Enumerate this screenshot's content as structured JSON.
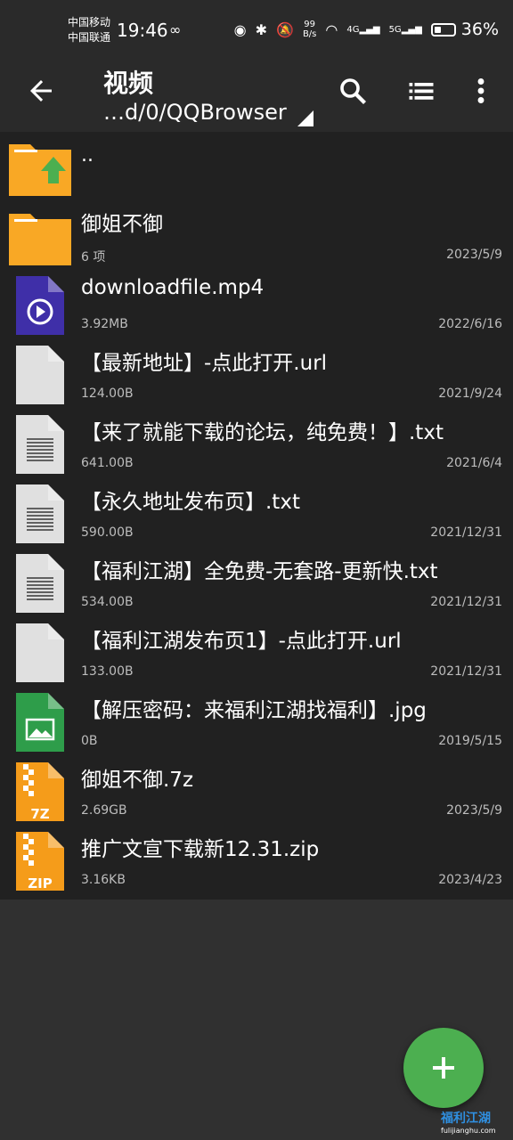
{
  "status": {
    "carrier1": "中国移动",
    "carrier2": "中国联通",
    "time": "19:46",
    "speed_value": "99",
    "speed_unit": "B/s",
    "signal1": "4G",
    "signal2": "5G",
    "battery": "36%",
    "battery_level": 0.36
  },
  "appbar": {
    "title": "视频",
    "path": "…d/0/QQBrowser"
  },
  "parent_dir": "..",
  "files": [
    {
      "name": "御姐不御",
      "meta": "6 项",
      "date": "2023/5/9",
      "type": "folder"
    },
    {
      "name": "downloadfile.mp4",
      "meta": "3.92MB",
      "date": "2022/6/16",
      "type": "video"
    },
    {
      "name": "【最新地址】-点此打开.url",
      "meta": "124.00B",
      "date": "2021/9/24",
      "type": "blank"
    },
    {
      "name": "【来了就能下载的论坛，纯免费！】.txt",
      "meta": "641.00B",
      "date": "2021/6/4",
      "type": "text"
    },
    {
      "name": "【永久地址发布页】.txt",
      "meta": "590.00B",
      "date": "2021/12/31",
      "type": "text"
    },
    {
      "name": "【福利江湖】全免费-无套路-更新快.txt",
      "meta": "534.00B",
      "date": "2021/12/31",
      "type": "text"
    },
    {
      "name": "【福利江湖发布页1】-点此打开.url",
      "meta": "133.00B",
      "date": "2021/12/31",
      "type": "blank"
    },
    {
      "name": "【解压密码：来福利江湖找福利】.jpg",
      "meta": "0B",
      "date": "2019/5/15",
      "type": "image"
    },
    {
      "name": "御姐不御.7z",
      "meta": "2.69GB",
      "date": "2023/5/9",
      "type": "archive",
      "badge": "7Z"
    },
    {
      "name": "推广文宣下载新12.31.zip",
      "meta": "3.16KB",
      "date": "2023/4/23",
      "type": "archive",
      "badge": "ZIP"
    }
  ],
  "watermark": {
    "main": "福利江湖",
    "sub": "fulijianghu.com"
  },
  "colors": {
    "folder": "#f9a825",
    "video": "#3f2fa8",
    "image": "#2e9d4a",
    "archive": "#f59c1a",
    "fab": "#4caf50"
  }
}
